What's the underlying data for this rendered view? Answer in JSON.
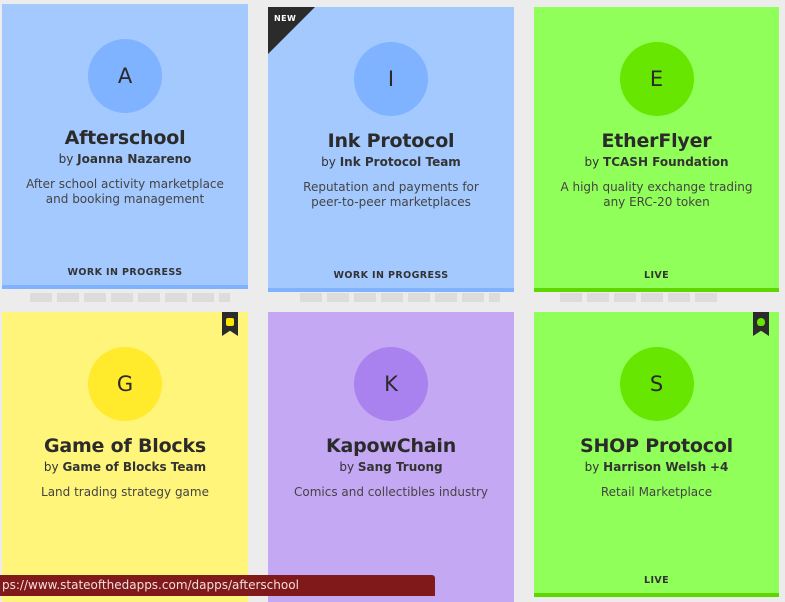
{
  "cards": [
    {
      "initial": "A",
      "title": "Afterschool",
      "by_prefix": "by",
      "author": "Joanna Nazareno",
      "description": "After school activity marketplace and booking management",
      "status": "WORK IN PROGRESS"
    },
    {
      "initial": "I",
      "title": "Ink Protocol",
      "by_prefix": "by",
      "author": "Ink Protocol Team",
      "description": "Reputation and payments for peer-to-peer marketplaces",
      "status": "WORK IN PROGRESS",
      "badge": "NEW"
    },
    {
      "initial": "E",
      "title": "EtherFlyer",
      "by_prefix": "by",
      "author": "TCASH Foundation",
      "description": "A high quality exchange trading any ERC-20 token",
      "status": "LIVE"
    },
    {
      "initial": "G",
      "title": "Game of Blocks",
      "by_prefix": "by",
      "author": "Game of Blocks Team",
      "description": "Land trading strategy game",
      "bookmark_icon": "puzzle-icon"
    },
    {
      "initial": "K",
      "title": "KapowChain",
      "by_prefix": "by",
      "author": "Sang Truong",
      "description": "Comics and collectibles industry"
    },
    {
      "initial": "S",
      "title": "SHOP Protocol",
      "by_prefix": "by",
      "author": "Harrison Welsh",
      "author_extra": "+4",
      "description": "Retail Marketplace",
      "status": "LIVE",
      "bookmark_icon": "flame-icon"
    }
  ],
  "status_bar": {
    "url": "ps://www.stateofthedapps.com/dapps/afterschool"
  },
  "colors": {
    "blue_card": "#a4c9ff",
    "green_card": "#91ff59",
    "yellow_card": "#fff57a",
    "purple_card": "#c4a8f4",
    "status_bar": "#801a1a"
  }
}
